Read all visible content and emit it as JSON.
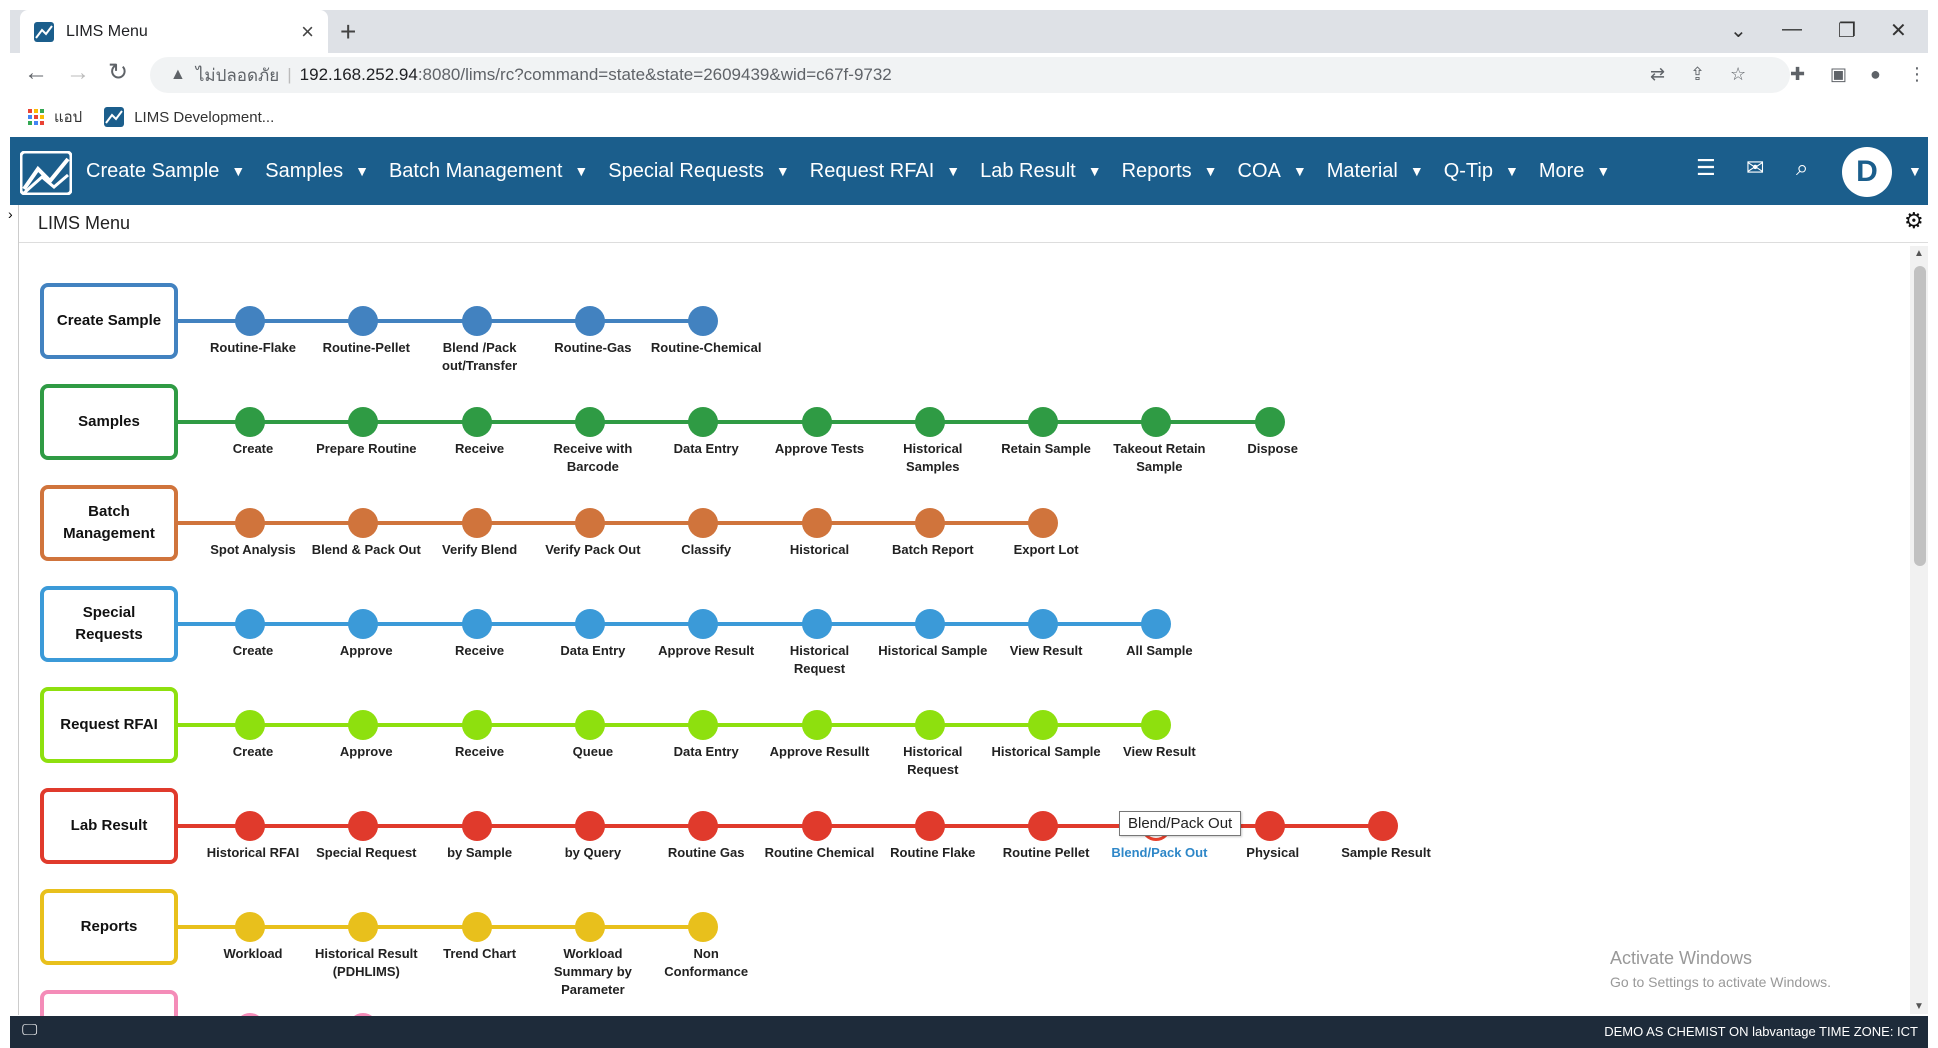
{
  "browser": {
    "tab_title": "LIMS Menu",
    "tab_close": "×",
    "new_tab": "+",
    "address_insecure_label": "ไม่ปลอดภัย",
    "address_host": "192.168.252.94",
    "address_path": ":8080/lims/rc?command=state&state=2609439&wid=c67f-9732",
    "bookmarks": [
      {
        "icon": "apps-grid-icon",
        "label": "แอป"
      },
      {
        "icon": "lims-logo-icon",
        "label": "LIMS Development..."
      }
    ]
  },
  "app": {
    "brand_color": "#1b5e8c",
    "menu": [
      "Create Sample",
      "Samples",
      "Batch Management",
      "Special Requests",
      "Request RFAI",
      "Lab Result",
      "Reports",
      "COA",
      "Material",
      "Q-Tip",
      "More"
    ],
    "user_initial": "D",
    "page_title": "LIMS Menu"
  },
  "categories": [
    {
      "name": "Create Sample",
      "color": "#4282c0",
      "items": [
        "Routine-Flake",
        "Routine-Pellet",
        "Blend /Pack out/Transfer",
        "Routine-Gas",
        "Routine-Chemical"
      ]
    },
    {
      "name": "Samples",
      "color": "#2f9b44",
      "items": [
        "Create",
        "Prepare Routine",
        "Receive",
        "Receive with Barcode",
        "Data Entry",
        "Approve Tests",
        "Historical Samples",
        "Retain Sample",
        "Takeout Retain Sample",
        "Dispose"
      ]
    },
    {
      "name": "Batch Management",
      "color": "#d0743c",
      "items": [
        "Spot Analysis",
        "Blend & Pack Out",
        "Verify Blend",
        "Verify Pack Out",
        "Classify",
        "Historical",
        "Batch Report",
        "Export Lot"
      ]
    },
    {
      "name": "Special Requests",
      "color": "#3b9ad8",
      "items": [
        "Create",
        "Approve",
        "Receive",
        "Data Entry",
        "Approve Result",
        "Historical Request",
        "Historical Sample",
        "View Result",
        "All Sample"
      ]
    },
    {
      "name": "Request RFAI",
      "color": "#8ee00e",
      "items": [
        "Create",
        "Approve",
        "Receive",
        "Queue",
        "Data Entry",
        "Approve Resullt",
        "Historical Request",
        "Historical Sample",
        "View Result"
      ]
    },
    {
      "name": "Lab Result",
      "color": "#e03a2c",
      "items": [
        "Historical RFAI",
        "Special Request",
        "by Sample",
        "by Query",
        "Routine Gas",
        "Routine Chemical",
        "Routine Flake",
        "Routine Pellet",
        "Blend/Pack Out",
        "Physical",
        "Sample Result"
      ],
      "hovered_index": 8
    },
    {
      "name": "Reports",
      "color": "#e8c01c",
      "items": [
        "Workload",
        "Historical Result (PDHLIMS)",
        "Trend Chart",
        "Workload Summary by Parameter",
        "Non Conformance"
      ]
    },
    {
      "name": "",
      "color": "#f48cb8",
      "items": [
        "",
        ""
      ]
    }
  ],
  "tooltip": "Blend/Pack Out",
  "watermark": {
    "title": "Activate Windows",
    "subtitle": "Go to Settings to activate Windows."
  },
  "status": "DEMO AS CHEMIST ON labvantage TIME ZONE: ICT"
}
